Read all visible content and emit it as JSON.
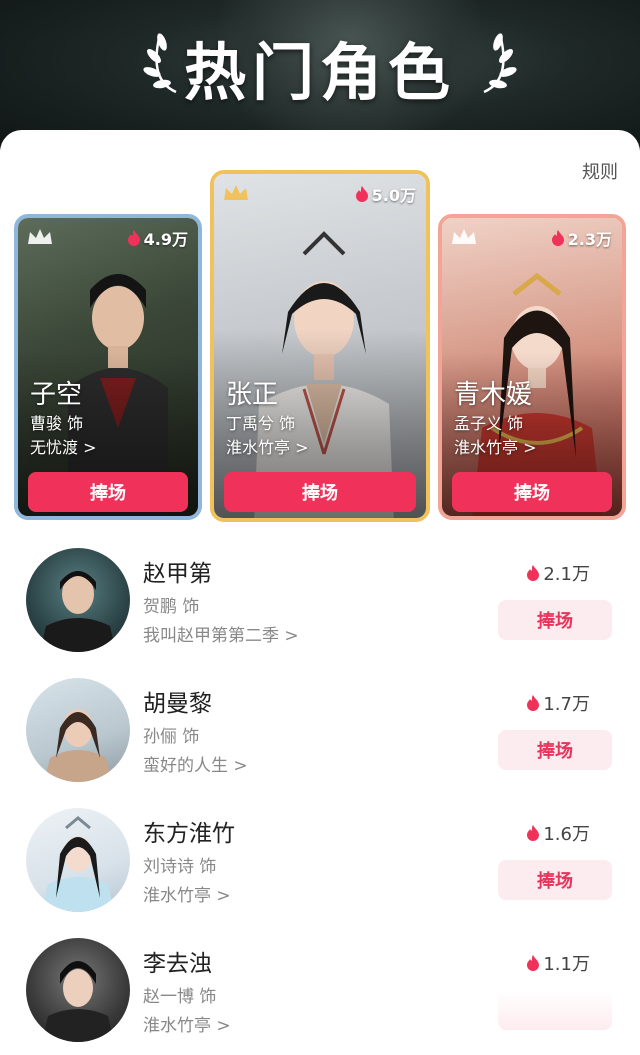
{
  "header": {
    "title": "热门角色"
  },
  "rules_label": "规则",
  "top3": [
    {
      "role": "子空",
      "actor": "曹骏 饰",
      "show": "无忧渡 >",
      "heat": "4.9万",
      "cheer": "捧场",
      "crown_color": "#8fb7dc"
    },
    {
      "role": "张正",
      "actor": "丁禹兮 饰",
      "show": "淮水竹亭 >",
      "heat": "5.0万",
      "cheer": "捧场",
      "crown_color": "#f0c25d"
    },
    {
      "role": "青木媛",
      "actor": "孟子义 饰",
      "show": "淮水竹亭 >",
      "heat": "2.3万",
      "cheer": "捧场",
      "crown_color": "#f2a596"
    }
  ],
  "list": [
    {
      "name": "赵甲第",
      "actor": "贺鹏 饰",
      "show": "我叫赵甲第第二季 >",
      "heat": "2.1万",
      "cheer": "捧场"
    },
    {
      "name": "胡曼黎",
      "actor": "孙俪 饰",
      "show": "蛮好的人生 >",
      "heat": "1.7万",
      "cheer": "捧场"
    },
    {
      "name": "东方淮竹",
      "actor": "刘诗诗 饰",
      "show": "淮水竹亭 >",
      "heat": "1.6万",
      "cheer": "捧场"
    },
    {
      "name": "李去浊",
      "actor": "赵一博 饰",
      "show": "淮水竹亭 >",
      "heat": "1.1万",
      "cheer": ""
    }
  ],
  "colors": {
    "accent": "#f0325a",
    "flame": "#f0325a",
    "soft_button": "#fdecef"
  }
}
